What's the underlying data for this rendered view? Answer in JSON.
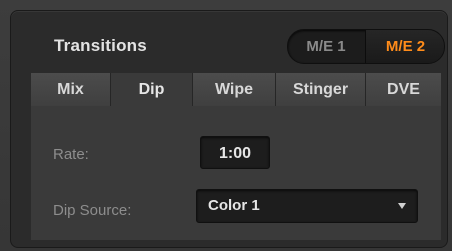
{
  "panel": {
    "title": "Transitions",
    "me_toggle": {
      "options": [
        "M/E 1",
        "M/E 2"
      ],
      "selected": "M/E 2",
      "active_color": "#ff8c1a"
    }
  },
  "tabs": [
    {
      "label": "Mix"
    },
    {
      "label": "Dip",
      "active": true
    },
    {
      "label": "Wipe"
    },
    {
      "label": "Stinger"
    },
    {
      "label": "DVE"
    }
  ],
  "dip": {
    "rate_label": "Rate:",
    "rate_value": "1:00",
    "source_label": "Dip Source:",
    "source_value": "Color 1",
    "dropdown_icon": "chevron-down-icon"
  }
}
